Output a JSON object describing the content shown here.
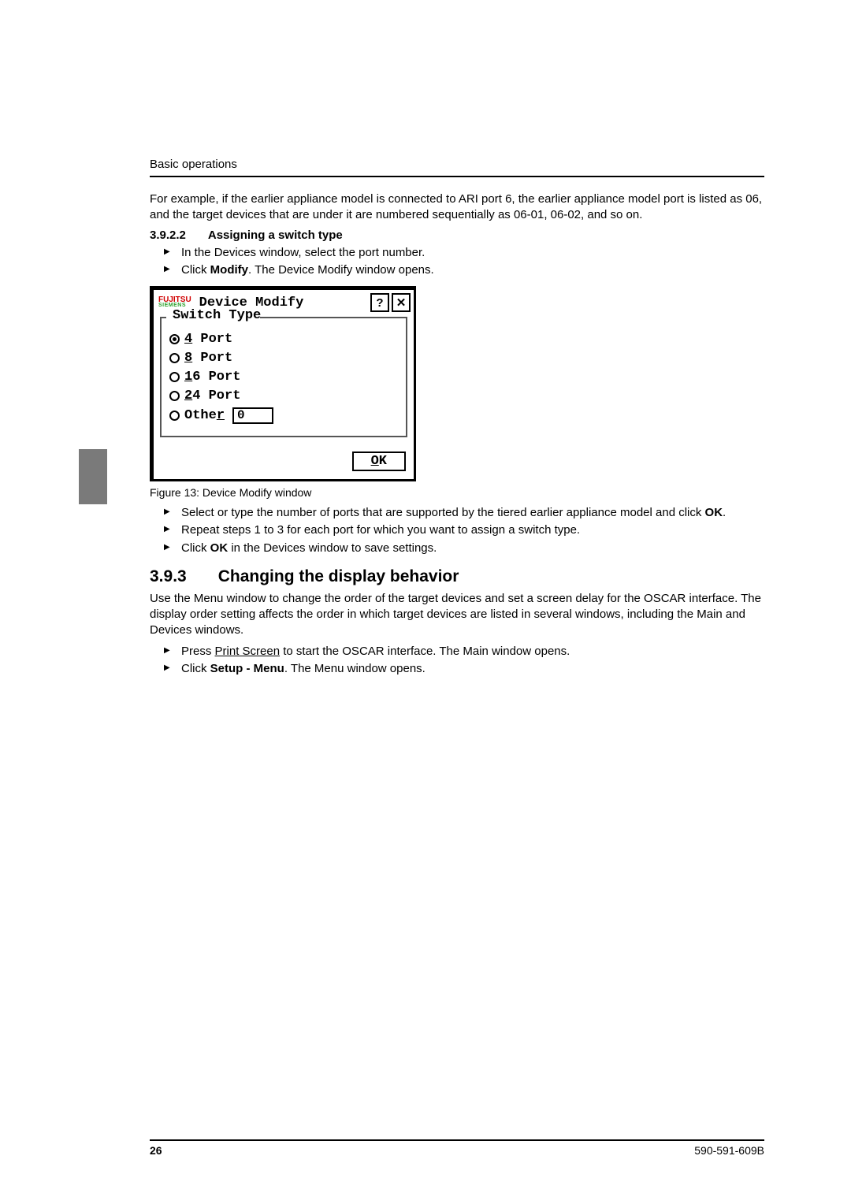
{
  "running_head": "Basic operations",
  "intro_paragraph": "For example, if the earlier appliance model is connected to ARI port 6, the earlier appliance model port is listed as 06, and the target devices that are under it are numbered sequentially as 06-01, 06-02, and so on.",
  "section_3922": {
    "number": "3.9.2.2",
    "title": "Assigning a switch type",
    "steps": {
      "s1": "In the Devices window, select the port number.",
      "s2_a": "Click ",
      "s2_b": "Modify",
      "s2_c": ". The Device Modify window opens."
    }
  },
  "dialog": {
    "logo_top": "FUJITSU",
    "logo_sub": "SIEMENS",
    "title": "Device Modify",
    "help": "?",
    "close": "✕",
    "legend": "Switch Type",
    "options": {
      "o1_ul": "4",
      "o1_rest": " Port",
      "o2_ul": "8",
      "o2_rest": " Port",
      "o3_ul": "1",
      "o3_rest": "6 Port",
      "o4_ul": "2",
      "o4_rest": "4 Port",
      "o5_pre": "Othe",
      "o5_ul": "r"
    },
    "other_value": "0",
    "ok_ul": "O",
    "ok_rest": "K"
  },
  "figure_caption": "Figure 13: Device Modify window",
  "post_steps": {
    "p1_a": "Select or type the number of ports that are supported by the tiered earlier appliance model and click ",
    "p1_b": "OK",
    "p1_c": ".",
    "p2": "Repeat steps 1 to 3 for each port for which you want to assign a switch type.",
    "p3_a": "Click ",
    "p3_b": "OK",
    "p3_c": " in the Devices window to save settings."
  },
  "section_393": {
    "number": "3.9.3",
    "title": "Changing the display behavior",
    "paragraph": "Use the Menu window to change the order of the target devices and set a screen delay for the OSCAR interface. The display order setting affects the order in which target devices are listed in several windows, including the Main and Devices windows.",
    "steps": {
      "s1_a": "Press ",
      "s1_key": "Print Screen",
      "s1_b": " to start the OSCAR interface. The Main window opens.",
      "s2_a": "Click ",
      "s2_b": "Setup - Menu",
      "s2_c": ". The Menu window opens."
    }
  },
  "footer": {
    "page": "26",
    "docnum": "590-591-609B"
  }
}
